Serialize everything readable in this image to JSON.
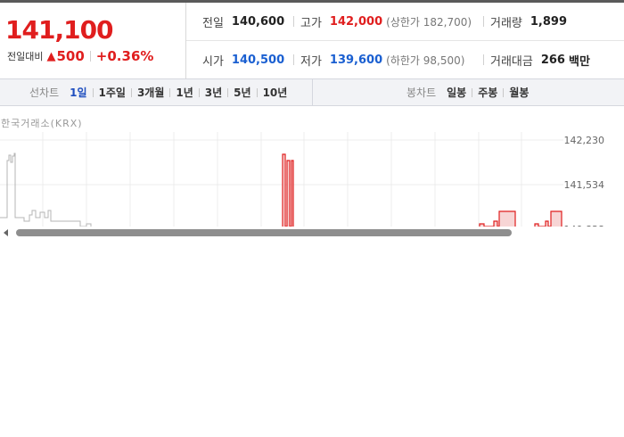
{
  "quote": {
    "price": "141,100",
    "change_label": "전일대비",
    "change_arrow": "▲",
    "change_value": "500",
    "change_percent": "+0.36%"
  },
  "stats": {
    "prev_close": {
      "label": "전일",
      "value": "140,600"
    },
    "high": {
      "label": "고가",
      "value": "142,000",
      "sub": "(상한가 182,700)"
    },
    "volume": {
      "label": "거래량",
      "value": "1,899"
    },
    "open": {
      "label": "시가",
      "value": "140,500"
    },
    "low": {
      "label": "저가",
      "value": "139,600",
      "sub": "(하한가 98,500)"
    },
    "amount": {
      "label": "거래대금",
      "value": "266",
      "unit": "백만"
    }
  },
  "line_chart_bar": {
    "title": "선차트",
    "options": [
      "1일",
      "1주일",
      "3개월",
      "1년",
      "3년",
      "5년",
      "10년"
    ],
    "active": "1일"
  },
  "candle_chart_bar": {
    "title": "봉차트",
    "options": [
      "일봉",
      "주봉",
      "월봉"
    ]
  },
  "source": "한국거래소(KRX)",
  "chart_data": {
    "type": "line",
    "y_ticks": [
      "142,230",
      "141,534",
      "140,838"
    ],
    "ylim": [
      140838,
      142230
    ],
    "grid": true,
    "price_series_color": "#e01e1e",
    "reference_series_color": "#b5b5b5"
  },
  "icons": {
    "scroll_left": "triangle-left-icon",
    "up_arrow": "triangle-up-icon"
  }
}
